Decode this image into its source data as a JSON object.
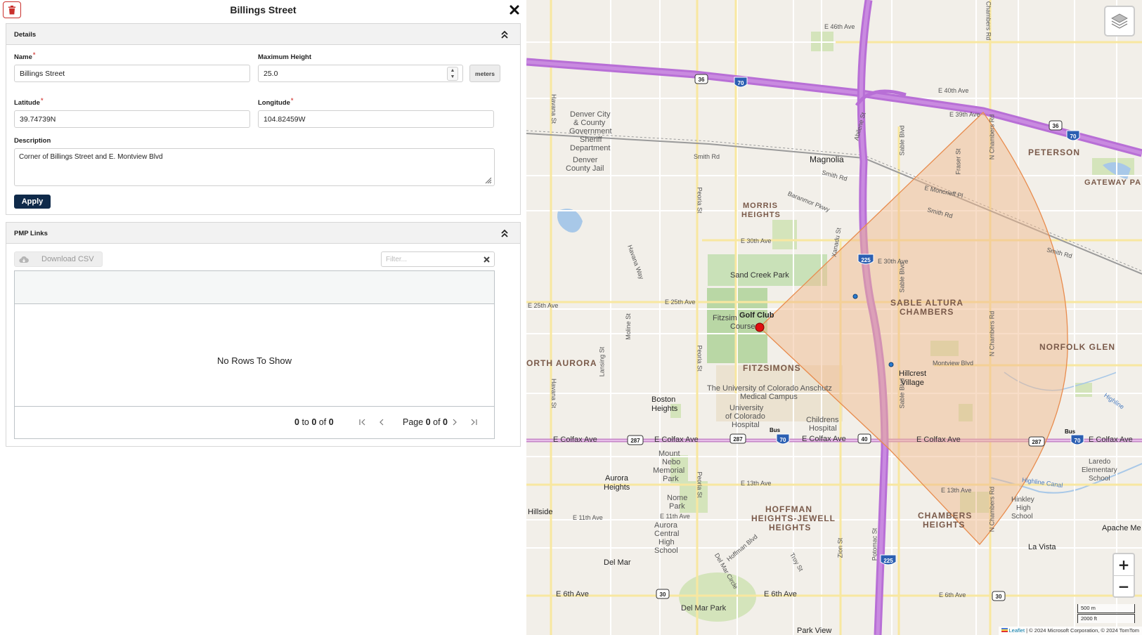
{
  "panel": {
    "title": "Billings Street",
    "details": {
      "header": "Details",
      "name_label": "Name",
      "name_value": "Billings Street",
      "max_height_label": "Maximum Height",
      "max_height_value": "25.0",
      "max_height_unit": "meters",
      "latitude_label": "Latitude",
      "latitude_value": "39.74739N",
      "longitude_label": "Longitude",
      "longitude_value": "104.82459W",
      "description_label": "Description",
      "description_value": "Corner of Billings Street and E. Montview Blvd",
      "required_mark": "*",
      "apply_label": "Apply"
    },
    "links": {
      "header": "PMP Links",
      "download_label": "Download CSV",
      "filter_placeholder": "Filter...",
      "empty_text": "No Rows To Show",
      "range_from": "0",
      "range_to": "0",
      "range_total": "0",
      "to_word": "to",
      "of_word": "of",
      "page_word": "Page",
      "page_current": "0",
      "page_total": "0"
    }
  },
  "map": {
    "attribution_leaflet": "Leaflet",
    "attribution_rest": "| © 2024 Microsoft Corporation, © 2024 TomTom",
    "scale_metric": "500 m",
    "scale_imperial": "2000 ft",
    "zoom_in": "+",
    "zoom_out": "−",
    "labels": {
      "peterson": "PETERSON",
      "gateway_pa": "GATEWAY PA",
      "magnolia": "Magnolia",
      "morris_1": "MORRIS",
      "morris_2": "HEIGHTS",
      "sable_1": "SABLE ALTURA",
      "sable_2": "CHAMBERS",
      "norfolk": "NORFOLK GLEN",
      "fitzsimons": "FITZSIMONS",
      "north_aurora": "ORTH AURORA",
      "hoffman_1": "HOFFMAN",
      "hoffman_2": "HEIGHTS-JEWELL",
      "hoffman_3": "HEIGHTS",
      "chambers_h1": "CHAMBERS",
      "chambers_h2": "HEIGHTS",
      "denver_1": "Denver City",
      "denver_2": "& County",
      "denver_3": "Government",
      "denver_4": "Sheriff",
      "denver_5": "Department",
      "jail_1": "Denver",
      "jail_2": "County Jail",
      "sand_creek": "Sand Creek Park",
      "golf_club": "Golf Club",
      "fitzsim": "Fitzsim",
      "course": "Course",
      "uc_1": "The University of Colorado Anschutz",
      "uc_2": "Medical Campus",
      "uch_1": "University",
      "uch_2": "of Colorado",
      "uch_3": "Hospital",
      "childrens_1": "Childrens",
      "childrens_2": "Hospital",
      "boston_1": "Boston",
      "boston_2": "Heights",
      "hillcrest_1": "Hillcrest",
      "hillcrest_2": "Village",
      "aurora_h1": "Aurora",
      "aurora_h2": "Heights",
      "mount_nebo_1": "Mount",
      "mount_nebo_2": "Nebo",
      "mount_nebo_3": "Memorial",
      "mount_nebo_4": "Park",
      "nome_1": "Nome",
      "nome_2": "Park",
      "achs_1": "Aurora",
      "achs_2": "Central",
      "achs_3": "High",
      "achs_4": "School",
      "hillside": "Hillside",
      "del_mar": "Del Mar",
      "del_mar_park": "Del Mar Park",
      "park_view": "Park View",
      "laredo_1": "Laredo",
      "laredo_2": "Elementary",
      "laredo_3": "School",
      "hinkley_1": "Hinkley",
      "hinkley_2": "High",
      "hinkley_3": "School",
      "apache": "Apache Me",
      "la_vista": "La Vista",
      "highline": "Highline Canal",
      "highline2": "Highline",
      "bus": "Bus",
      "e_colfax": "E Colfax Ave",
      "e_46th": "E 46th Ave",
      "e_40th": "E 40th Ave",
      "e_39th": "E 39th Ave",
      "e_30th": "E 30th Ave",
      "e_25th": "E 25th Ave",
      "e_13th": "E 13th Ave",
      "e_11th": "E 11th Ave",
      "e_6th": "E 6th Ave",
      "smith_rd": "Smith Rd",
      "montview": "Montview Blvd",
      "moncrieff": "E Moncrieff Pl",
      "baranmor": "Baranmor Pkwy",
      "havana_way": "Havana Way",
      "peoria": "Peoria St",
      "havana_st": "Havana St",
      "sable": "Sable Blvd",
      "chambers_rd": "N Chambers Rd",
      "fraser": "Fraser St",
      "xanadu": "Xanadu St",
      "abilene": "Abilene St",
      "potomac": "Potomac St",
      "zion": "Zion St",
      "troy": "Troy St",
      "moline": "Moline St",
      "lansing": "Lansing St",
      "hoffman_blvd": "Hoffman Blvd",
      "del_mar_circle": "Del Mar Circle"
    },
    "shields": {
      "i70": "70",
      "i225": "225",
      "us36": "36",
      "us287": "287",
      "us40": "40",
      "us30": "30"
    }
  }
}
